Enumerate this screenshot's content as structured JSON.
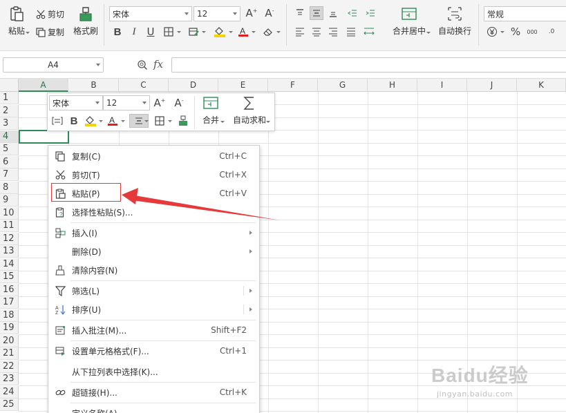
{
  "ribbon": {
    "paste": "粘贴",
    "cut": "剪切",
    "copy": "复制",
    "format_painter": "格式刷",
    "font_name": "宋体",
    "font_size": "12",
    "merge_center": "合并居中",
    "wrap_text": "自动换行",
    "number_format": "常规",
    "percent": "%",
    "decimal_inc": "000",
    "decimal_dec": ".0"
  },
  "formula_bar": {
    "cell_ref": "A4",
    "fx": "fx",
    "value": ""
  },
  "columns": [
    "A",
    "B",
    "C",
    "D",
    "E",
    "F",
    "G",
    "H",
    "I",
    "J",
    "K"
  ],
  "rows": [
    "1",
    "2",
    "3",
    "4",
    "5",
    "6",
    "7",
    "8",
    "9",
    "10",
    "11",
    "12",
    "13",
    "14",
    "15",
    "16",
    "17",
    "18",
    "19",
    "20",
    "21",
    "22",
    "23",
    "24",
    "25"
  ],
  "selected_cell": "A4",
  "mini_toolbar": {
    "font_name": "宋体",
    "font_size": "12",
    "merge": "合并",
    "autosum": "自动求和"
  },
  "context_menu": {
    "items": [
      {
        "label": "复制(C)",
        "shortcut": "Ctrl+C"
      },
      {
        "label": "剪切(T)",
        "shortcut": "Ctrl+X"
      },
      {
        "label": "粘贴(P)",
        "shortcut": "Ctrl+V"
      },
      {
        "label": "选择性粘贴(S)...",
        "shortcut": ""
      },
      {
        "label": "插入(I)",
        "shortcut": ""
      },
      {
        "label": "删除(D)",
        "shortcut": ""
      },
      {
        "label": "清除内容(N)",
        "shortcut": ""
      },
      {
        "label": "筛选(L)",
        "shortcut": ""
      },
      {
        "label": "排序(U)",
        "shortcut": ""
      },
      {
        "label": "插入批注(M)...",
        "shortcut": "Shift+F2"
      },
      {
        "label": "设置单元格格式(F)...",
        "shortcut": "Ctrl+1"
      },
      {
        "label": "从下拉列表中选择(K)...",
        "shortcut": ""
      },
      {
        "label": "超链接(H)...",
        "shortcut": "Ctrl+K"
      },
      {
        "label": "定义名称(A)...",
        "shortcut": ""
      }
    ]
  },
  "watermark": {
    "text": "Baidu经验",
    "sub": "jingyan.baidu.com"
  },
  "colors": {
    "accent_green": "#2e8b57",
    "highlight_red": "#e23a3a",
    "font_red": "#e02020",
    "fill_yellow": "#f5d400"
  }
}
